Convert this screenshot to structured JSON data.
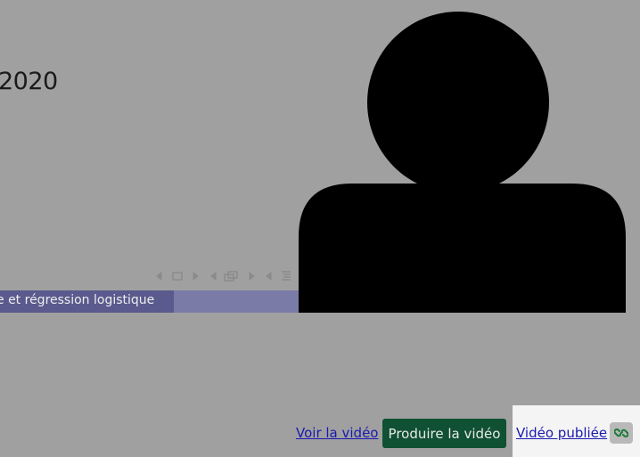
{
  "slide": {
    "year_text": "2020",
    "footer_text": "e et régression logistique"
  },
  "toolbar": {
    "view_video_label": "Voir la vidéo",
    "produce_video_label": "Produire la vidéo",
    "published_video_label": "Vidéo publiée",
    "link_icon": "link-icon"
  },
  "colors": {
    "page_background": "#a0a0a0",
    "produce_button": "#0f5132",
    "link_text": "#1a1ab0",
    "footer_band_dark": "#5a5a8e",
    "footer_band_light": "#7b7ba8",
    "link_icon_green": "#1e7a3a"
  }
}
